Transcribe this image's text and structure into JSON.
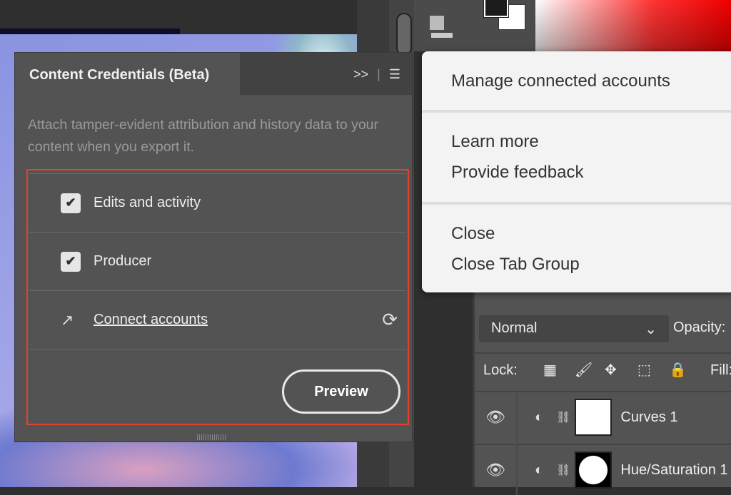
{
  "panel": {
    "title": "Content Credentials (Beta)",
    "expand_icon": ">>",
    "menu_icon": "hamburger",
    "description": "Attach tamper-evident attribution and history data to your content when you export it.",
    "options": [
      {
        "label": "Edits and activity",
        "checked": true
      },
      {
        "label": "Producer",
        "checked": true
      }
    ],
    "connect_label": "Connect accounts",
    "preview_label": "Preview"
  },
  "menu": {
    "items": [
      "Manage connected accounts",
      "Learn more",
      "Provide feedback",
      "Close",
      "Close Tab Group"
    ]
  },
  "layers": {
    "blend_mode": "Normal",
    "opacity_label": "Opacity:",
    "lock_label": "Lock:",
    "fill_label": "Fill:",
    "rows": [
      {
        "name": "Curves 1"
      },
      {
        "name": "Hue/Saturation 1"
      }
    ]
  },
  "colors": {
    "accent_outline": "#e0442c",
    "panel_bg": "#535353",
    "menu_bg": "#f3f3f3"
  }
}
